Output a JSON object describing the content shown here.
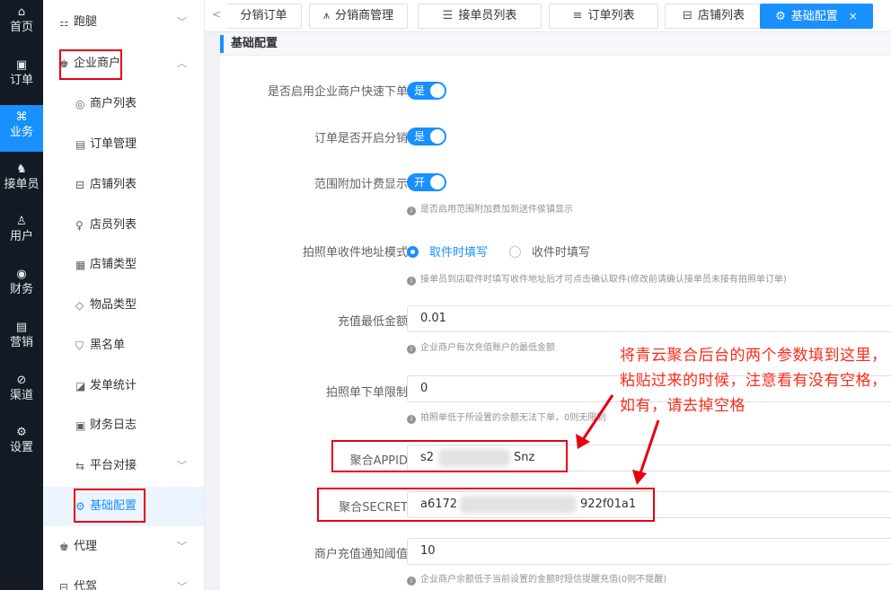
{
  "rail": [
    {
      "icon": "home-icon",
      "glyph": "⌂",
      "label": "首页"
    },
    {
      "icon": "order-icon",
      "glyph": "▣",
      "label": "订单"
    },
    {
      "icon": "business-icon",
      "glyph": "⌘",
      "label": "业务",
      "active": true
    },
    {
      "icon": "courier-icon",
      "glyph": "♞",
      "label": "接单员"
    },
    {
      "icon": "user-icon",
      "glyph": "♙",
      "label": "用户"
    },
    {
      "icon": "finance-icon",
      "glyph": "◉",
      "label": "财务"
    },
    {
      "icon": "marketing-icon",
      "glyph": "▤",
      "label": "营销"
    },
    {
      "icon": "channel-icon",
      "glyph": "⊘",
      "label": "渠道"
    },
    {
      "icon": "settings-icon",
      "glyph": "⚙",
      "label": "设置"
    }
  ],
  "sidebar": {
    "errand": {
      "glyph": "⚏",
      "label": "跑腿"
    },
    "enterprise": {
      "glyph": "♚",
      "label": "企业商户"
    },
    "sub": [
      {
        "glyph": "◎",
        "label": "商户列表"
      },
      {
        "glyph": "▤",
        "label": "订单管理"
      },
      {
        "glyph": "⊟",
        "label": "店铺列表"
      },
      {
        "glyph": "♀",
        "label": "店员列表"
      },
      {
        "glyph": "▦",
        "label": "店铺类型"
      },
      {
        "glyph": "◇",
        "label": "物品类型"
      },
      {
        "glyph": "⛉",
        "label": "黑名单"
      },
      {
        "glyph": "◪",
        "label": "发单统计"
      },
      {
        "glyph": "▣",
        "label": "财务日志"
      },
      {
        "glyph": "⇆",
        "label": "平台对接"
      },
      {
        "glyph": "⚙",
        "label": "基础配置"
      }
    ],
    "agent": {
      "glyph": "♚",
      "label": "代理"
    },
    "agent2": {
      "glyph": "⊟",
      "label": "代驾"
    }
  },
  "tabs": [
    {
      "label": "分销订单",
      "icon": ""
    },
    {
      "label": "分销商管理",
      "icon": "⩚"
    },
    {
      "label": "接单员列表",
      "icon": "☰"
    },
    {
      "label": "订单列表",
      "icon": "≡"
    },
    {
      "label": "店铺列表",
      "icon": "⊟"
    },
    {
      "label": "基础配置",
      "icon": "⚙",
      "active": true
    }
  ],
  "tab_back": "<",
  "tab_close": "×",
  "section_title": "基础配置",
  "form": {
    "quick_order": {
      "label": "是否启用企业商户快速下单",
      "value": "是"
    },
    "distribution": {
      "label": "订单是否开启分销",
      "value": "是"
    },
    "range_fee": {
      "label": "范围附加计费显示",
      "value": "开",
      "help": "是否启用范围附加费加到送件侯镇显示"
    },
    "address_mode": {
      "label": "拍照单收件地址模式",
      "options": [
        "取件时填写",
        "收件时填写"
      ],
      "selected": 0,
      "help": "接单员到店取件时填写收件地址后才可点击确认取件(修改前请确认接单员未接有拍照单订单)"
    },
    "min_recharge": {
      "label": "充值最低金额",
      "value": "0.01",
      "help": "企业商户每次充值账户的最低金额"
    },
    "photo_limit": {
      "label": "拍照单下单限制",
      "value": "0",
      "help": "拍照单低于所设置的余额无法下单，0则无限制"
    },
    "appid": {
      "label": "聚合APPID",
      "value_prefix": "s2",
      "value_suffix": "Snz"
    },
    "secret": {
      "label": "聚合SECRET",
      "value_prefix": "a6172",
      "value_suffix": "922f01a1"
    },
    "notify_threshold": {
      "label": "商户充值通知阈值",
      "value": "10",
      "help": "企业商户余额低于当前设置的金额时短信提醒充值(0则不提醒)"
    }
  },
  "annotation": "将青云聚合后台的两个参数填到这里，粘贴过来的时候，注意看有没有空格，如有，请去掉空格",
  "colors": {
    "accent": "#1890ff",
    "annotation_red": "#e60012",
    "rail_bg": "#141a23"
  }
}
